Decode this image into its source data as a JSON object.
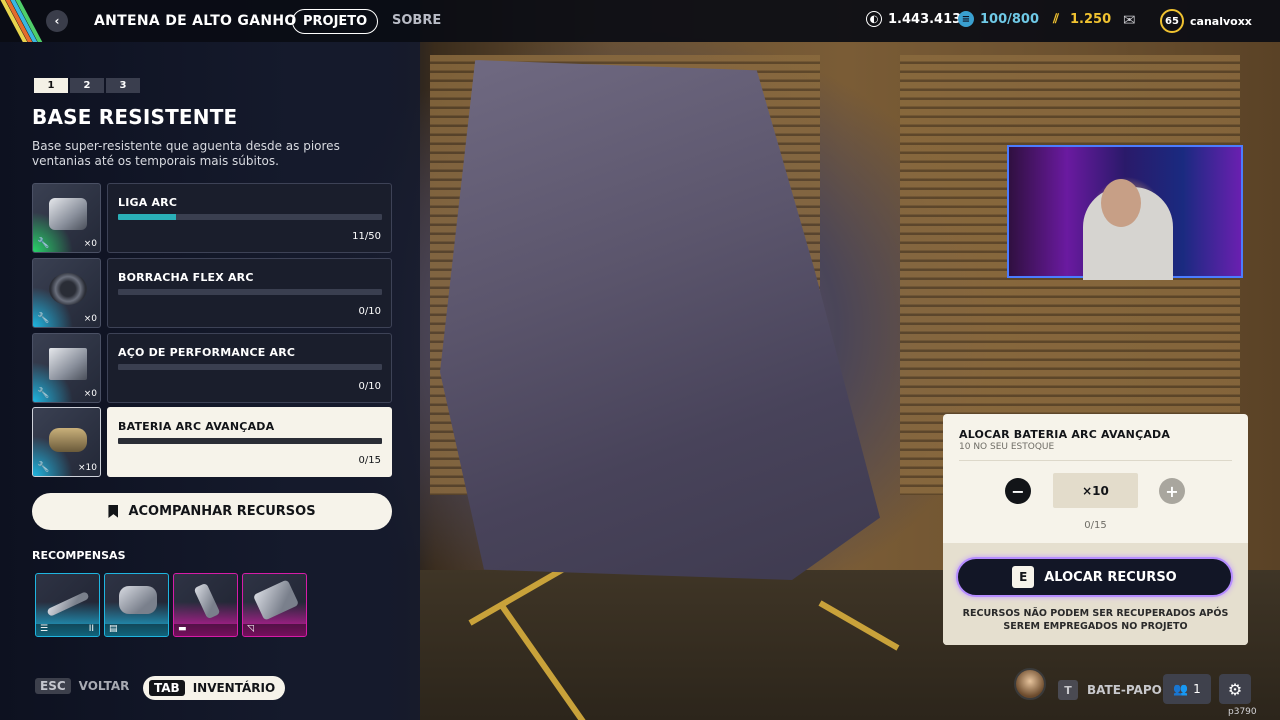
{
  "header": {
    "title": "ANTENA DE ALTO GANHO",
    "tabs": [
      {
        "label": "PROJETO",
        "active": true
      },
      {
        "label": "SOBRE",
        "active": false
      }
    ],
    "stats": {
      "currency": "1.443.413",
      "capacity": "100/800",
      "tokens": "1.250"
    },
    "user": {
      "level": "65",
      "name": "canalvoxx"
    }
  },
  "project": {
    "pages": [
      "1",
      "2",
      "3"
    ],
    "active_page": 0,
    "title": "BASE RESISTENTE",
    "description": "Base super-resistente que aguenta desde as piores ventanias até os temporais mais súbitos."
  },
  "resources": [
    {
      "name": "LIGA ARC",
      "owned": "×0",
      "progress_text": "11/50",
      "progress": 0.22,
      "glow": "#28d46a",
      "highlight": false
    },
    {
      "name": "BORRACHA FLEX ARC",
      "owned": "×0",
      "progress_text": "0/10",
      "progress": 0,
      "glow": "#1fb5e0",
      "highlight": false
    },
    {
      "name": "AÇO DE PERFORMANCE ARC",
      "owned": "×0",
      "progress_text": "0/10",
      "progress": 0,
      "glow": "#1fb5e0",
      "highlight": false
    },
    {
      "name": "BATERIA ARC AVANÇADA",
      "owned": "×10",
      "progress_text": "0/15",
      "progress": 0,
      "glow": "#1fb5e0",
      "highlight": true
    }
  ],
  "track_button": "ACOMPANHAR RECURSOS",
  "rewards": {
    "label": "RECOMPENSAS",
    "items": [
      {
        "glow": "#1fb5e0",
        "foot": "II"
      },
      {
        "glow": "#1fb5e0",
        "foot": ""
      },
      {
        "glow": "#d61ca8",
        "foot": ""
      },
      {
        "glow": "#d61ca8",
        "foot": ""
      }
    ]
  },
  "footer": {
    "back_key": "ESC",
    "back_label": "VOLTAR",
    "inv_key": "TAB",
    "inv_label": "INVENTÁRIO",
    "chat_key": "T",
    "chat_label": "BATE-PAPO",
    "friends_count": "1",
    "build": "p3790"
  },
  "allocate": {
    "title": "ALOCAR BATERIA ARC AVANÇADA",
    "subtitle": "10 NO SEU ESTOQUE",
    "quantity": "×10",
    "minus": "−",
    "plus": "+",
    "progress": "0/15",
    "button_key": "E",
    "button_label": "ALOCAR RECURSO",
    "warning": "RECURSOS NÃO PODEM SER RECUPERADOS APÓS SEREM EMPREGADOS NO PROJETO"
  },
  "colors": {
    "accent_teal": "#2ab0b8",
    "cream": "#f6f3ea",
    "gold": "#f0c230",
    "purple_glow": "#b58cff"
  }
}
